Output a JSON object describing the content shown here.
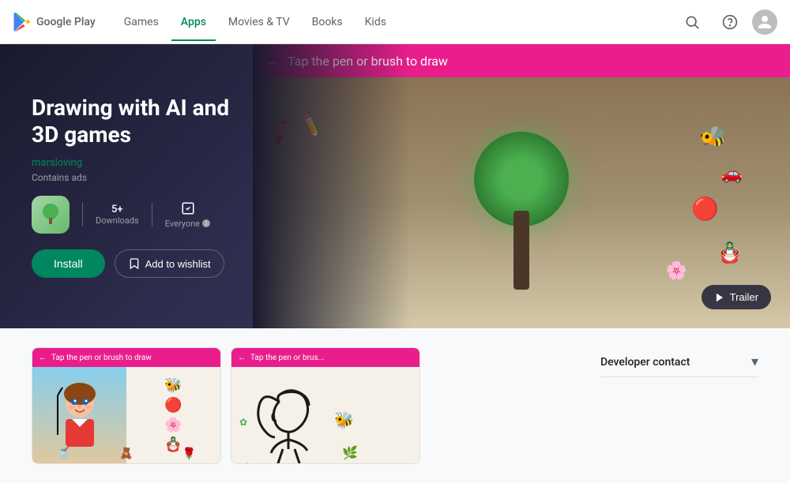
{
  "header": {
    "logo_text": "Google Play",
    "nav_items": [
      {
        "label": "Games",
        "active": false
      },
      {
        "label": "Apps",
        "active": true
      },
      {
        "label": "Movies & TV",
        "active": false
      },
      {
        "label": "Books",
        "active": false
      },
      {
        "label": "Kids",
        "active": false
      }
    ],
    "search_tooltip": "Search",
    "help_tooltip": "Help",
    "account_tooltip": "Account"
  },
  "hero": {
    "app_title": "Drawing with AI and\n3D games",
    "developer_name": "marsloving",
    "contains_ads": "Contains ads",
    "downloads": "5+",
    "downloads_label": "Downloads",
    "rating_label": "Everyone",
    "install_label": "Install",
    "wishlist_label": "Add to wishlist",
    "trailer_label": "Trailer",
    "screenshot_text": "Tap the pen or brush to draw"
  },
  "screenshots": [
    {
      "pink_bar_text": "Tap the pen or brush to draw"
    },
    {
      "pink_bar_text": "Tap the pen or brus..."
    }
  ],
  "sidebar": {
    "developer_contact_label": "Developer contact",
    "chevron": "▾"
  },
  "icons": {
    "search": "🔍",
    "help": "?",
    "back_arrow": "←",
    "bookmark": "🔖",
    "play": "▶"
  }
}
